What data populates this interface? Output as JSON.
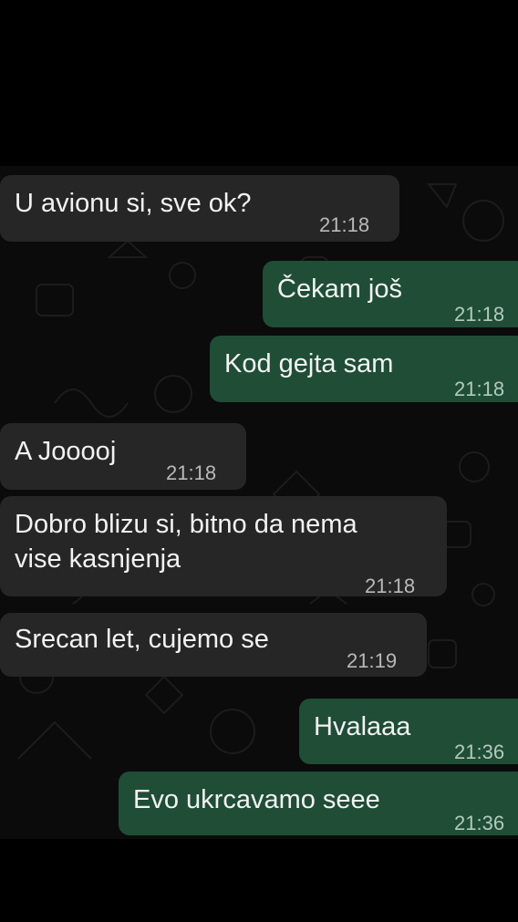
{
  "chat": {
    "messages": [
      {
        "direction": "incoming",
        "lines": [
          "U avionu si, sve ok?"
        ],
        "time": "21:18"
      },
      {
        "direction": "outgoing",
        "lines": [
          "Čekam još"
        ],
        "time": "21:18"
      },
      {
        "direction": "outgoing",
        "lines": [
          "Kod gejta sam"
        ],
        "time": "21:18"
      },
      {
        "direction": "incoming",
        "lines": [
          "A Jooooj"
        ],
        "time": "21:18"
      },
      {
        "direction": "incoming",
        "lines": [
          "Dobro blizu si, bitno da nema",
          "vise kasnjenja"
        ],
        "time": "21:18"
      },
      {
        "direction": "incoming",
        "lines": [
          "Srecan let, cujemo se"
        ],
        "time": "21:19"
      },
      {
        "direction": "outgoing",
        "lines": [
          "Hvalaaa"
        ],
        "time": "21:36"
      },
      {
        "direction": "outgoing",
        "lines": [
          "Evo ukrcavamo seee"
        ],
        "time": "21:36"
      }
    ]
  },
  "colors": {
    "page_background": "#000000",
    "chat_background": "#0b0b0b",
    "incoming_bubble": "#262626",
    "outgoing_bubble": "#1f4d36",
    "message_text": "#f2f2f2",
    "timestamp_text": "#b9b9b9"
  }
}
